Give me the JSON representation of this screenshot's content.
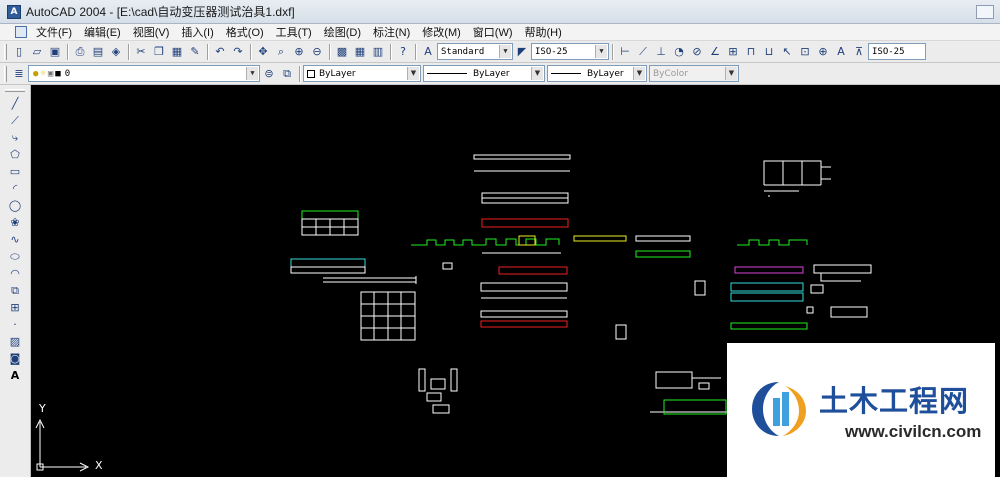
{
  "window": {
    "title": "AutoCAD 2004 - [E:\\cad\\自动变压器测试治具1.dxf]",
    "app_icon_glyph": "A"
  },
  "menu": {
    "items": [
      "文件(F)",
      "编辑(E)",
      "视图(V)",
      "插入(I)",
      "格式(O)",
      "工具(T)",
      "绘图(D)",
      "标注(N)",
      "修改(M)",
      "窗口(W)",
      "帮助(H)"
    ]
  },
  "toolbar1": {
    "text_style": "Standard",
    "dim_style_left": "ISO-25",
    "dim_style_right": "ISO-25"
  },
  "toolbar2": {
    "layer": "0",
    "color": "ByLayer",
    "linetype": "ByLayer",
    "lineweight": "ByLayer",
    "plotstyle": "ByColor"
  },
  "ucs": {
    "x_label": "X",
    "y_label": "Y"
  },
  "watermark": {
    "name": "土木工程网",
    "url": "www.civilcn.com"
  },
  "colors": {
    "canvas_bg": "#000000",
    "drawing_white": "#ffffff",
    "drawing_green": "#22ee22",
    "drawing_red": "#ee2222",
    "drawing_cyan": "#33dddd",
    "drawing_magenta": "#dd44dd",
    "drawing_yellow": "#eeee22",
    "brand_blue": "#1f4f9a"
  }
}
